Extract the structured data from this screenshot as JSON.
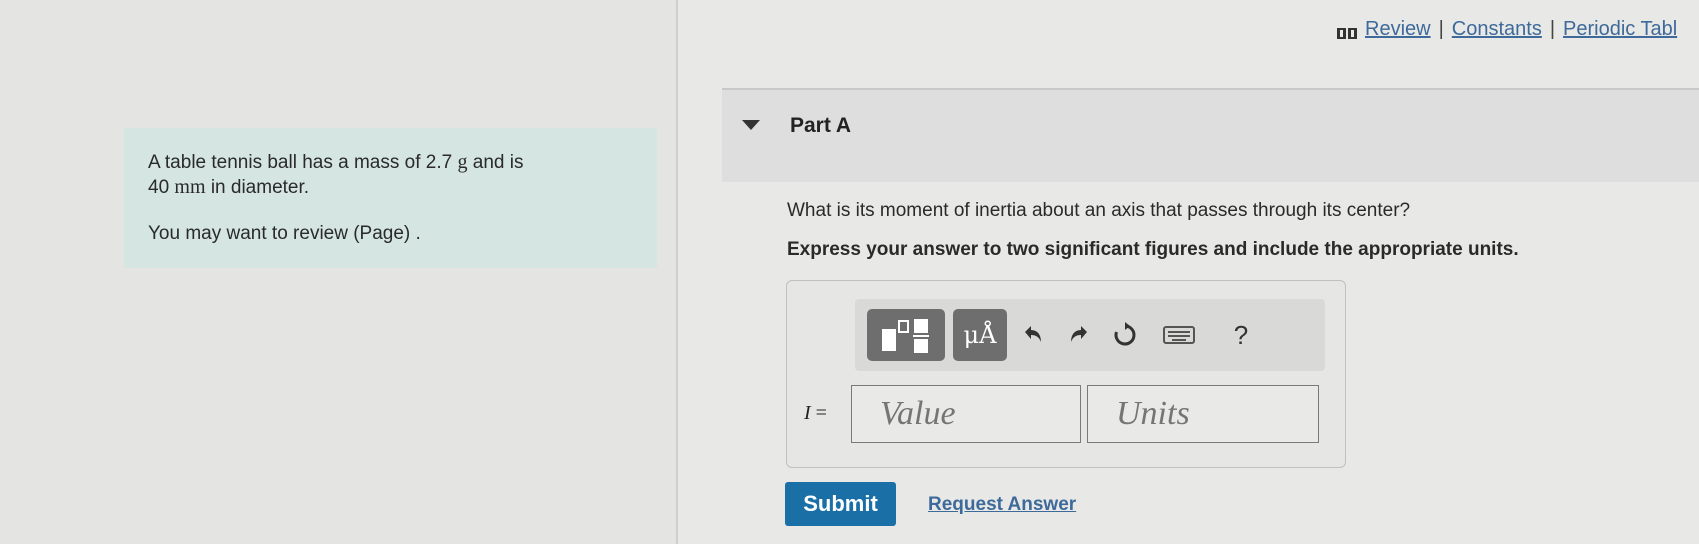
{
  "problem": {
    "line1_pre": "A table tennis ball has a mass of 2.7 ",
    "mass_unit": "g",
    "line1_post": " and is",
    "line2_value": "40 ",
    "diameter_unit": "mm",
    "line2_post": " in diameter.",
    "review_text": "You may want to review (Page) ."
  },
  "top_links": {
    "review": "Review",
    "constants": "Constants",
    "periodic_table": "Periodic Tabl",
    "separator": "|"
  },
  "part": {
    "title": "Part A",
    "question": "What is its moment of inertia about an axis that passes through its center?",
    "instruction": "Express your answer to two significant figures and include the appropriate units."
  },
  "toolbar": {
    "units_label": "μÅ",
    "help_label": "?",
    "icons": [
      "templates-icon",
      "undo-icon",
      "redo-icon",
      "reset-icon",
      "keyboard-icon"
    ]
  },
  "answer": {
    "variable": "I",
    "equals": " =",
    "value_placeholder": "Value",
    "units_placeholder": "Units"
  },
  "actions": {
    "submit_label": "Submit",
    "request_answer_label": "Request Answer"
  },
  "colors": {
    "problem_bg": "#d4e5e2",
    "link": "#3d6a9a",
    "submit_bg": "#1a6fa6",
    "toolbar_button": "#6e6e6e"
  }
}
